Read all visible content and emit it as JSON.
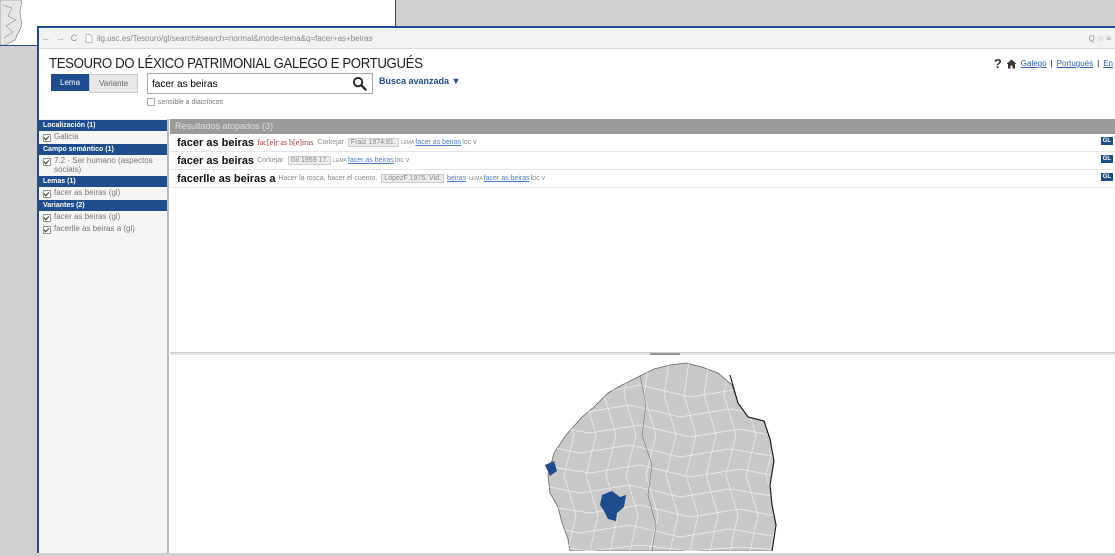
{
  "browser": {
    "back": "←",
    "forward": "→",
    "reload": "C",
    "url": "ilg.usc.es/Tesouro/gl/search#search=normal&mode=lema&q=facer+as+beiras",
    "right_controls": "Q ☆ ≡"
  },
  "site": {
    "title": "TESOURO DO LÉXICO PATRIMONIAL GALEGO E PORTUGUÉS",
    "help": "?",
    "lang_galego": "Galego",
    "sep1": "|",
    "lang_portugues": "Portugués",
    "sep2": "|",
    "lang_english": "En"
  },
  "search": {
    "toggle_lema": "Lema",
    "toggle_variante": "Variante",
    "query": "facer as beiras",
    "advanced": "Busca avanzada ▼",
    "diacritics": "sensible a diacríticos"
  },
  "filters": [
    {
      "header": "Localización (1)",
      "items": [
        "Galicia"
      ]
    },
    {
      "header": "Campo semántico (1)",
      "items": [
        "7.2 - Ser humano (aspectos sociais)"
      ]
    },
    {
      "header": "Lemas (1)",
      "items": [
        "facer as beiras (gl)"
      ]
    },
    {
      "header": "Variantes (2)",
      "items": [
        "facer as beiras (gl)",
        "facerlle as beiras a (gl)"
      ]
    }
  ],
  "results": {
    "header": "Resultados atopados (3)",
    "rows": [
      {
        "lemma": "facer as beiras",
        "variant": "fac[e]r as b[e]iras",
        "place": "Corkejar",
        "source": "Fraiz 1974:81.",
        "lema_tag": "LEMA",
        "lema_link": "facer as beiras",
        "cat": "loc v",
        "gl": "GL"
      },
      {
        "lemma": "facer as beiras",
        "variant": "",
        "place": "Corkejar",
        "source": "Gil 1959 17.",
        "lema_tag": "LEMA",
        "lema_link": "facer as beiras",
        "cat": "loc v",
        "gl": "GL"
      },
      {
        "lemma": "facerlle as beiras a",
        "variant": "",
        "place": "Hacer la rosca, hacer el cuento.",
        "source": "LópezF 1975. Vid.",
        "vid_link": "beiras",
        "lema_tag": "LEMA",
        "lema_link": "facer as beiras",
        "cat": "loc v",
        "gl": "GL"
      }
    ]
  },
  "map": {
    "land_color": "#c8c8c8",
    "highlight_color": "#1f4c8c",
    "border_color": "#555555"
  }
}
